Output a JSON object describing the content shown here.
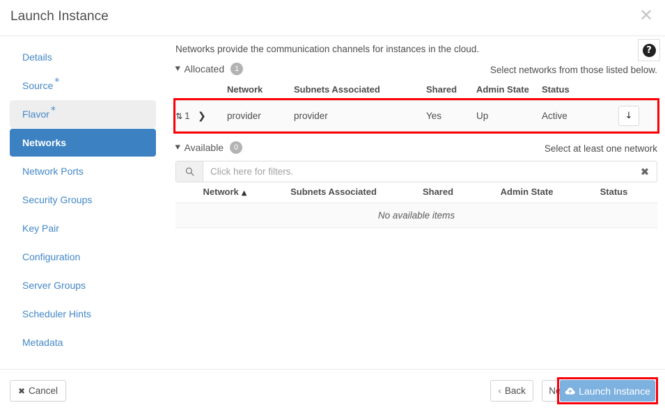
{
  "window": {
    "title": "Launch Instance",
    "close_icon": "close-icon"
  },
  "sidebar": {
    "items": [
      {
        "label": "Details",
        "required": "",
        "state": "normal"
      },
      {
        "label": "Source",
        "required": "*",
        "state": "normal"
      },
      {
        "label": "Flavor",
        "required": "*",
        "state": "hovered"
      },
      {
        "label": "Networks",
        "required": "",
        "state": "active"
      },
      {
        "label": "Network Ports",
        "required": "",
        "state": "normal"
      },
      {
        "label": "Security Groups",
        "required": "",
        "state": "normal"
      },
      {
        "label": "Key Pair",
        "required": "",
        "state": "normal"
      },
      {
        "label": "Configuration",
        "required": "",
        "state": "normal"
      },
      {
        "label": "Server Groups",
        "required": "",
        "state": "normal"
      },
      {
        "label": "Scheduler Hints",
        "required": "",
        "state": "normal"
      },
      {
        "label": "Metadata",
        "required": "",
        "state": "normal"
      }
    ]
  },
  "content": {
    "intro": "Networks provide the communication channels for instances in the cloud.",
    "help_icon": "help-circle-icon",
    "help_glyph": "?",
    "allocated": {
      "label": "Allocated",
      "count": "1",
      "hint": "Select networks from those listed below.",
      "caret": "⌄",
      "columns": [
        "",
        "",
        "Network",
        "Subnets Associated",
        "Shared",
        "Admin State",
        "Status",
        ""
      ],
      "rows": [
        {
          "order": "1",
          "sort_handle": "⇅",
          "expand": "❯",
          "network": "provider",
          "subnets": "provider",
          "shared": "Yes",
          "admin_state": "Up",
          "status": "Active",
          "action_icon": "arrow-down-icon",
          "action_glyph": "↓"
        }
      ]
    },
    "available": {
      "label": "Available",
      "count": "0",
      "hint": "Select at least one network",
      "caret": "⌄",
      "filter": {
        "placeholder": "Click here for filters.",
        "value": "",
        "search_icon": "search-icon",
        "search_glyph": "⌕",
        "clear_icon": "clear-icon",
        "clear_glyph": "✖"
      },
      "columns": [
        "Network",
        "Subnets Associated",
        "Shared",
        "Admin State",
        "Status"
      ],
      "sort_indicator": "▲",
      "empty_message": "No available items"
    }
  },
  "footer": {
    "cancel": {
      "label": "Cancel",
      "icon_glyph": "✖"
    },
    "back": {
      "label": "Back",
      "icon_glyph": "‹"
    },
    "next": {
      "label": "Next",
      "icon_glyph": "›"
    },
    "launch": {
      "label": "Launch Instance",
      "icon": "cloud-upload-icon"
    }
  },
  "colors": {
    "accent_blue": "#3c82c3",
    "link_blue": "#4387c7",
    "highlight_red": "#fb0007",
    "launch_button": "#7db1e0"
  }
}
